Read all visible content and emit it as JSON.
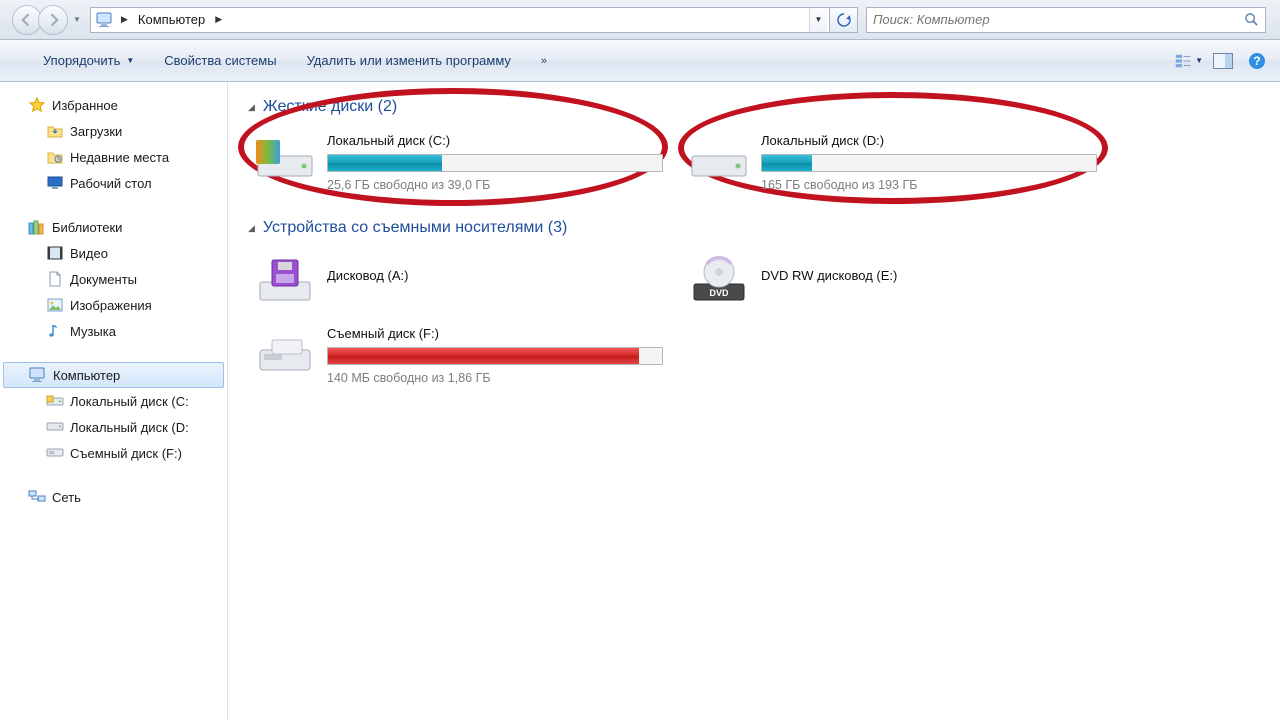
{
  "breadcrumb": {
    "location": "Компьютер"
  },
  "search": {
    "placeholder": "Поиск: Компьютер"
  },
  "toolbar": {
    "organize": "Упорядочить",
    "properties": "Свойства системы",
    "uninstall": "Удалить или изменить программу"
  },
  "sidebar": {
    "favorites": {
      "label": "Избранное",
      "items": [
        "Загрузки",
        "Недавние места",
        "Рабочий стол"
      ]
    },
    "libraries": {
      "label": "Библиотеки",
      "items": [
        "Видео",
        "Документы",
        "Изображения",
        "Музыка"
      ]
    },
    "computer": {
      "label": "Компьютер",
      "items": [
        "Локальный диск  (C:",
        "Локальный диск (D:",
        "Съемный диск (F:)"
      ]
    },
    "network": {
      "label": "Сеть"
    }
  },
  "sections": {
    "hdd": {
      "title": "Жесткие диски (2)"
    },
    "remov": {
      "title": "Устройства со съемными носителями (3)"
    }
  },
  "drives": {
    "c": {
      "name": "Локальный диск  (C:)",
      "sub": "25,6 ГБ свободно из 39,0 ГБ",
      "fill_pct": 34,
      "color": "blue"
    },
    "d": {
      "name": "Локальный диск (D:)",
      "sub": "165 ГБ свободно из 193 ГБ",
      "fill_pct": 15,
      "color": "blue"
    },
    "a": {
      "name": "Дисковод (A:)"
    },
    "dvd": {
      "name": "DVD RW дисковод (E:)"
    },
    "f": {
      "name": "Съемный диск (F:)",
      "sub": "140 МБ свободно из 1,86 ГБ",
      "fill_pct": 93,
      "color": "red"
    }
  }
}
